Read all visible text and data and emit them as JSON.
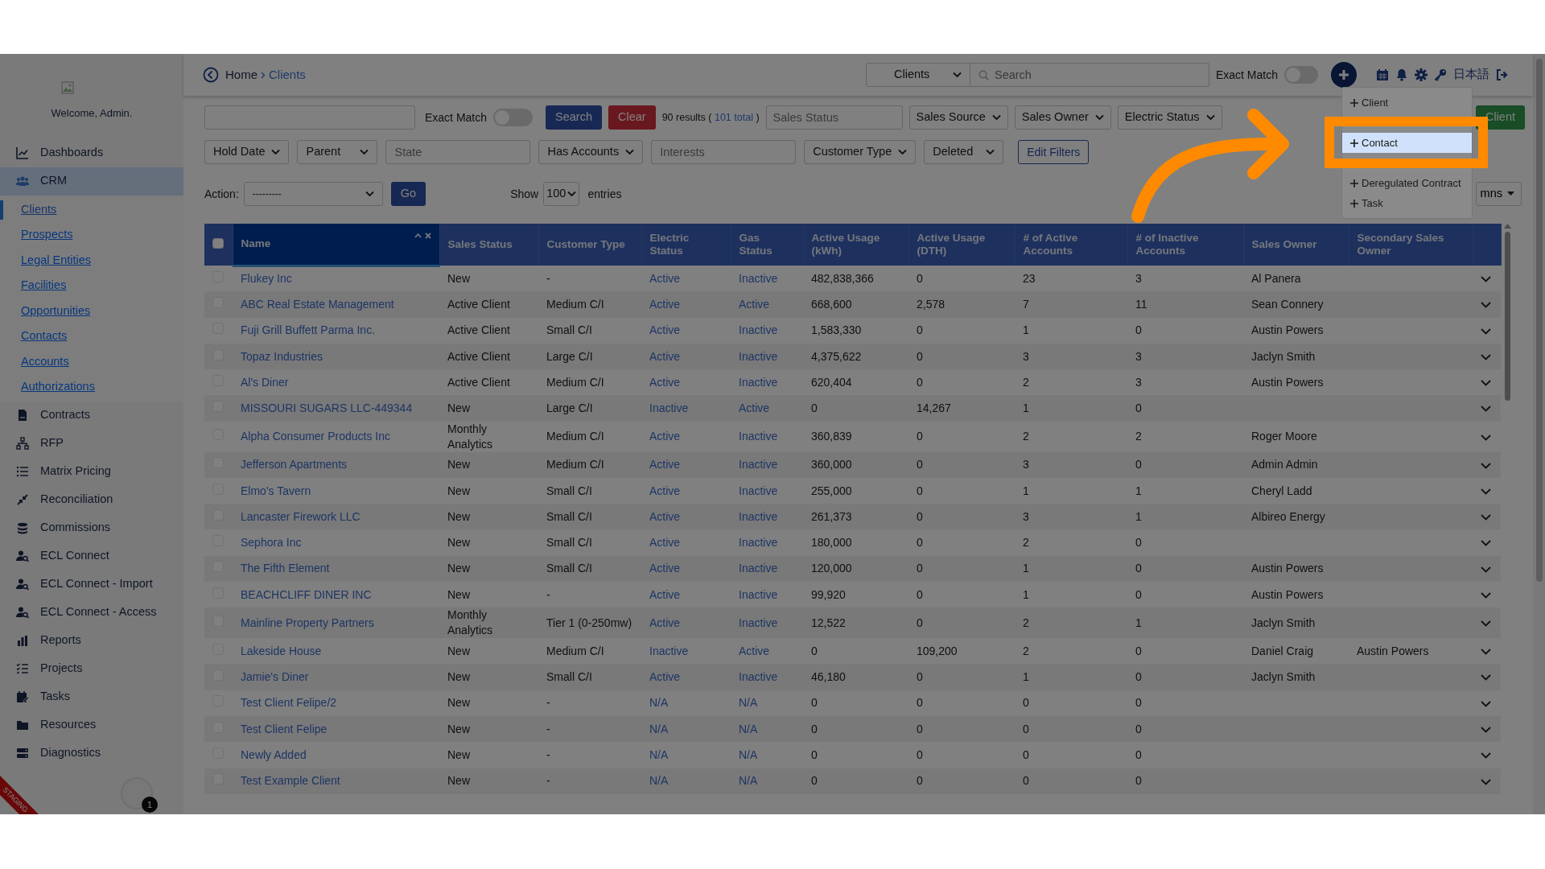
{
  "sidebar": {
    "welcome": "Welcome, Admin.",
    "items": [
      {
        "label": "Dashboards",
        "selected": false
      },
      {
        "label": "CRM",
        "selected": true,
        "expanded": true,
        "children": [
          {
            "label": "Clients",
            "selected": true
          },
          {
            "label": "Prospects",
            "selected": false
          },
          {
            "label": "Legal Entities",
            "selected": false
          },
          {
            "label": "Facilities",
            "selected": false
          },
          {
            "label": "Opportunities",
            "selected": false
          },
          {
            "label": "Contacts",
            "selected": false
          },
          {
            "label": "Accounts",
            "selected": false
          },
          {
            "label": "Authorizations",
            "selected": false
          }
        ]
      },
      {
        "label": "Contracts",
        "selected": false
      },
      {
        "label": "RFP",
        "selected": false
      },
      {
        "label": "Matrix Pricing",
        "selected": false
      },
      {
        "label": "Reconciliation",
        "selected": false
      },
      {
        "label": "Commissions",
        "selected": false
      },
      {
        "label": "ECL Connect",
        "selected": false
      },
      {
        "label": "ECL Connect - Import",
        "selected": false
      },
      {
        "label": "ECL Connect - Access",
        "selected": false
      },
      {
        "label": "Reports",
        "selected": false
      },
      {
        "label": "Projects",
        "selected": false
      },
      {
        "label": "Tasks",
        "selected": false
      },
      {
        "label": "Resources",
        "selected": false
      },
      {
        "label": "Diagnostics",
        "selected": false
      }
    ],
    "ribbon": "STAGING",
    "notifications": "1"
  },
  "breadcrumb": [
    "Home",
    "Clients"
  ],
  "topbar": {
    "scope": "Clients",
    "search_placeholder": "Search",
    "exact_match_label": "Exact Match",
    "exact_match_on": false,
    "language": "日本語"
  },
  "add_menu": {
    "items": [
      {
        "kind": "item",
        "label": "Client",
        "selected": false
      },
      {
        "kind": "covered"
      },
      {
        "kind": "item",
        "label": "Contact",
        "selected": true
      },
      {
        "kind": "covered"
      },
      {
        "kind": "item",
        "label": "Deregulated Contract",
        "selected": false
      },
      {
        "kind": "item",
        "label": "Task",
        "selected": false
      }
    ]
  },
  "filters": {
    "exact_match_label": "Exact Match",
    "exact_match_on": false,
    "search_button": "Search",
    "clear_button": "Clear",
    "results": "90 results (",
    "total": "101 total",
    "results_end": ")",
    "row1": [
      {
        "kind": "input",
        "placeholder": "Sales Status"
      },
      {
        "kind": "select",
        "label": "Sales Source"
      },
      {
        "kind": "select",
        "label": "Sales Owner"
      },
      {
        "kind": "select",
        "label": "Electric Status"
      }
    ],
    "add_button": "Client",
    "row2": [
      {
        "kind": "select",
        "label": "Hold Date"
      },
      {
        "kind": "select",
        "label": "Parent"
      },
      {
        "kind": "input",
        "placeholder": "State"
      },
      {
        "kind": "select",
        "label": "Has Accounts"
      },
      {
        "kind": "input",
        "placeholder": "Interests"
      },
      {
        "kind": "select",
        "label": "Customer Type"
      },
      {
        "kind": "select",
        "label": "Deleted"
      },
      {
        "kind": "button",
        "label": "Edit Filters"
      }
    ],
    "action_label": "Action:",
    "action_value": "---------",
    "go_button": "Go",
    "show_label": "Show",
    "show_value": "100",
    "entries_label": "entries",
    "columns_button": "mns"
  },
  "table": {
    "select_all_checked": false,
    "columns": [
      {
        "label": "Name",
        "sorted": true
      },
      {
        "label": "Sales Status",
        "sorted": false
      },
      {
        "label": "Customer Type",
        "sorted": false
      },
      {
        "label": "Electric Status",
        "sorted": false
      },
      {
        "label": "Gas Status",
        "sorted": false
      },
      {
        "label": "Active Usage (kWh)",
        "sorted": false
      },
      {
        "label": "Active Usage (DTH)",
        "sorted": false
      },
      {
        "label": "# of Active Accounts",
        "sorted": false
      },
      {
        "label": "# of Inactive Accounts",
        "sorted": false
      },
      {
        "label": "Sales Owner",
        "sorted": false
      },
      {
        "label": "Secondary Sales Owner",
        "sorted": false
      }
    ],
    "rows": [
      {
        "checked": false,
        "cells": [
          "Flukey Inc",
          "New",
          "-",
          "Active",
          "Inactive",
          "482,838,366",
          "0",
          "23",
          "3",
          "Al Panera",
          ""
        ]
      },
      {
        "checked": false,
        "cells": [
          "ABC Real Estate Management",
          "Active Client",
          "Medium C/I",
          "Active",
          "Active",
          "668,600",
          "2,578",
          "7",
          "11",
          "Sean Connery",
          ""
        ]
      },
      {
        "checked": false,
        "cells": [
          "Fuji Grill Buffett Parma Inc.",
          "Active Client",
          "Small C/I",
          "Active",
          "Inactive",
          "1,583,330",
          "0",
          "1",
          "0",
          "Austin Powers",
          ""
        ]
      },
      {
        "checked": false,
        "cells": [
          "Topaz Industries",
          "Active Client",
          "Large C/I",
          "Active",
          "Inactive",
          "4,375,622",
          "0",
          "3",
          "3",
          "Jaclyn Smith",
          ""
        ]
      },
      {
        "checked": false,
        "cells": [
          "Al's Diner",
          "Active Client",
          "Medium C/I",
          "Active",
          "Inactive",
          "620,404",
          "0",
          "2",
          "3",
          "Austin Powers",
          ""
        ]
      },
      {
        "checked": false,
        "cells": [
          "MISSOURI SUGARS LLC-449344",
          "New",
          "Large C/I",
          "Inactive",
          "Active",
          "0",
          "14,267",
          "1",
          "0",
          "",
          ""
        ]
      },
      {
        "checked": false,
        "cells": [
          "Alpha Consumer Products Inc",
          "Monthly Analytics",
          "Medium C/I",
          "Active",
          "Inactive",
          "360,839",
          "0",
          "2",
          "2",
          "Roger Moore",
          ""
        ]
      },
      {
        "checked": false,
        "cells": [
          "Jefferson Apartments",
          "New",
          "Medium C/I",
          "Active",
          "Inactive",
          "360,000",
          "0",
          "3",
          "0",
          "Admin Admin",
          ""
        ]
      },
      {
        "checked": false,
        "cells": [
          "Elmo's Tavern",
          "New",
          "Small C/I",
          "Active",
          "Inactive",
          "255,000",
          "0",
          "1",
          "1",
          "Cheryl Ladd",
          ""
        ]
      },
      {
        "checked": false,
        "cells": [
          "Lancaster Firework LLC",
          "New",
          "Small C/I",
          "Active",
          "Inactive",
          "261,373",
          "0",
          "3",
          "1",
          "Albireo Energy",
          ""
        ]
      },
      {
        "checked": false,
        "cells": [
          "Sephora Inc",
          "New",
          "Small C/I",
          "Active",
          "Inactive",
          "180,000",
          "0",
          "2",
          "0",
          "",
          ""
        ]
      },
      {
        "checked": false,
        "cells": [
          "The Fifth Element",
          "New",
          "Small C/I",
          "Active",
          "Inactive",
          "120,000",
          "0",
          "1",
          "0",
          "Austin Powers",
          ""
        ]
      },
      {
        "checked": false,
        "cells": [
          "BEACHCLIFF DINER INC",
          "New",
          "-",
          "Active",
          "Inactive",
          "99,920",
          "0",
          "1",
          "0",
          "Austin Powers",
          ""
        ]
      },
      {
        "checked": false,
        "cells": [
          "Mainline Property Partners",
          "Monthly Analytics",
          "Tier 1 (0-250mw)",
          "Active",
          "Inactive",
          "12,522",
          "0",
          "2",
          "1",
          "Jaclyn Smith",
          ""
        ]
      },
      {
        "checked": false,
        "cells": [
          "Lakeside House",
          "New",
          "Medium C/I",
          "Inactive",
          "Active",
          "0",
          "109,200",
          "2",
          "0",
          "Daniel Craig",
          "Austin Powers"
        ]
      },
      {
        "checked": false,
        "cells": [
          "Jamie's Diner",
          "New",
          "Small C/I",
          "Active",
          "Inactive",
          "46,180",
          "0",
          "1",
          "0",
          "Jaclyn Smith",
          ""
        ]
      },
      {
        "checked": false,
        "cells": [
          "Test Client Felipe/2",
          "New",
          "-",
          "N/A",
          "N/A",
          "0",
          "0",
          "0",
          "0",
          "",
          ""
        ]
      },
      {
        "checked": false,
        "cells": [
          "Test Client Felipe",
          "New",
          "-",
          "N/A",
          "N/A",
          "0",
          "0",
          "0",
          "0",
          "",
          ""
        ]
      },
      {
        "checked": false,
        "cells": [
          "Newly Added",
          "New",
          "-",
          "N/A",
          "N/A",
          "0",
          "0",
          "0",
          "0",
          "",
          ""
        ]
      },
      {
        "checked": false,
        "cells": [
          "Test Example Client",
          "New",
          "-",
          "N/A",
          "N/A",
          "0",
          "0",
          "0",
          "0",
          "",
          ""
        ]
      }
    ]
  }
}
